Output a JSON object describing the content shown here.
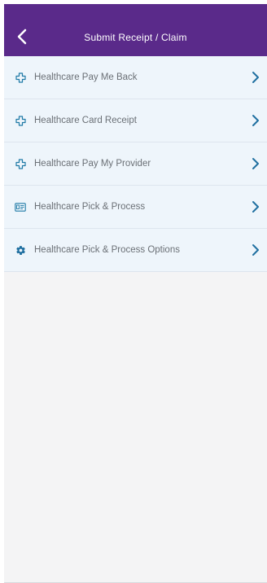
{
  "header": {
    "title": "Submit Receipt / Claim",
    "back_icon": "chevron-left-icon",
    "background": "#5a2a8a"
  },
  "menu": {
    "items": [
      {
        "label": "Healthcare Pay Me Back",
        "icon": "medical-cross-icon"
      },
      {
        "label": "Healthcare Card Receipt",
        "icon": "medical-cross-icon"
      },
      {
        "label": "Healthcare Pay My Provider",
        "icon": "medical-cross-icon"
      },
      {
        "label": "Healthcare Pick & Process",
        "icon": "id-card-icon"
      },
      {
        "label": "Healthcare Pick & Process Options",
        "icon": "gear-icon"
      }
    ],
    "accent": "#1f7aa6",
    "chevron_color": "#1f6fa0"
  }
}
